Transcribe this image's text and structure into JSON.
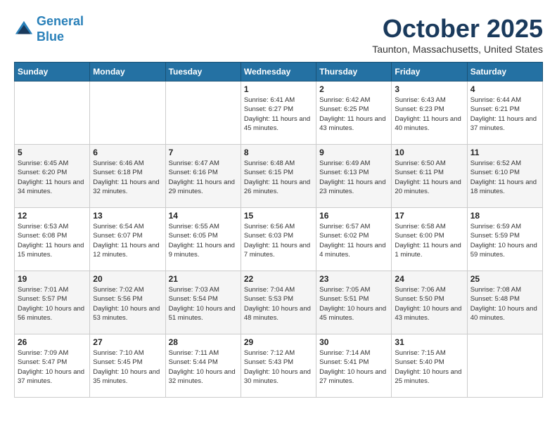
{
  "header": {
    "logo_line1": "General",
    "logo_line2": "Blue",
    "month_title": "October 2025",
    "location": "Taunton, Massachusetts, United States"
  },
  "weekdays": [
    "Sunday",
    "Monday",
    "Tuesday",
    "Wednesday",
    "Thursday",
    "Friday",
    "Saturday"
  ],
  "weeks": [
    [
      {
        "day": "",
        "info": ""
      },
      {
        "day": "",
        "info": ""
      },
      {
        "day": "",
        "info": ""
      },
      {
        "day": "1",
        "info": "Sunrise: 6:41 AM\nSunset: 6:27 PM\nDaylight: 11 hours\nand 45 minutes."
      },
      {
        "day": "2",
        "info": "Sunrise: 6:42 AM\nSunset: 6:25 PM\nDaylight: 11 hours\nand 43 minutes."
      },
      {
        "day": "3",
        "info": "Sunrise: 6:43 AM\nSunset: 6:23 PM\nDaylight: 11 hours\nand 40 minutes."
      },
      {
        "day": "4",
        "info": "Sunrise: 6:44 AM\nSunset: 6:21 PM\nDaylight: 11 hours\nand 37 minutes."
      }
    ],
    [
      {
        "day": "5",
        "info": "Sunrise: 6:45 AM\nSunset: 6:20 PM\nDaylight: 11 hours\nand 34 minutes."
      },
      {
        "day": "6",
        "info": "Sunrise: 6:46 AM\nSunset: 6:18 PM\nDaylight: 11 hours\nand 32 minutes."
      },
      {
        "day": "7",
        "info": "Sunrise: 6:47 AM\nSunset: 6:16 PM\nDaylight: 11 hours\nand 29 minutes."
      },
      {
        "day": "8",
        "info": "Sunrise: 6:48 AM\nSunset: 6:15 PM\nDaylight: 11 hours\nand 26 minutes."
      },
      {
        "day": "9",
        "info": "Sunrise: 6:49 AM\nSunset: 6:13 PM\nDaylight: 11 hours\nand 23 minutes."
      },
      {
        "day": "10",
        "info": "Sunrise: 6:50 AM\nSunset: 6:11 PM\nDaylight: 11 hours\nand 20 minutes."
      },
      {
        "day": "11",
        "info": "Sunrise: 6:52 AM\nSunset: 6:10 PM\nDaylight: 11 hours\nand 18 minutes."
      }
    ],
    [
      {
        "day": "12",
        "info": "Sunrise: 6:53 AM\nSunset: 6:08 PM\nDaylight: 11 hours\nand 15 minutes."
      },
      {
        "day": "13",
        "info": "Sunrise: 6:54 AM\nSunset: 6:07 PM\nDaylight: 11 hours\nand 12 minutes."
      },
      {
        "day": "14",
        "info": "Sunrise: 6:55 AM\nSunset: 6:05 PM\nDaylight: 11 hours\nand 9 minutes."
      },
      {
        "day": "15",
        "info": "Sunrise: 6:56 AM\nSunset: 6:03 PM\nDaylight: 11 hours\nand 7 minutes."
      },
      {
        "day": "16",
        "info": "Sunrise: 6:57 AM\nSunset: 6:02 PM\nDaylight: 11 hours\nand 4 minutes."
      },
      {
        "day": "17",
        "info": "Sunrise: 6:58 AM\nSunset: 6:00 PM\nDaylight: 11 hours\nand 1 minute."
      },
      {
        "day": "18",
        "info": "Sunrise: 6:59 AM\nSunset: 5:59 PM\nDaylight: 10 hours\nand 59 minutes."
      }
    ],
    [
      {
        "day": "19",
        "info": "Sunrise: 7:01 AM\nSunset: 5:57 PM\nDaylight: 10 hours\nand 56 minutes."
      },
      {
        "day": "20",
        "info": "Sunrise: 7:02 AM\nSunset: 5:56 PM\nDaylight: 10 hours\nand 53 minutes."
      },
      {
        "day": "21",
        "info": "Sunrise: 7:03 AM\nSunset: 5:54 PM\nDaylight: 10 hours\nand 51 minutes."
      },
      {
        "day": "22",
        "info": "Sunrise: 7:04 AM\nSunset: 5:53 PM\nDaylight: 10 hours\nand 48 minutes."
      },
      {
        "day": "23",
        "info": "Sunrise: 7:05 AM\nSunset: 5:51 PM\nDaylight: 10 hours\nand 45 minutes."
      },
      {
        "day": "24",
        "info": "Sunrise: 7:06 AM\nSunset: 5:50 PM\nDaylight: 10 hours\nand 43 minutes."
      },
      {
        "day": "25",
        "info": "Sunrise: 7:08 AM\nSunset: 5:48 PM\nDaylight: 10 hours\nand 40 minutes."
      }
    ],
    [
      {
        "day": "26",
        "info": "Sunrise: 7:09 AM\nSunset: 5:47 PM\nDaylight: 10 hours\nand 37 minutes."
      },
      {
        "day": "27",
        "info": "Sunrise: 7:10 AM\nSunset: 5:45 PM\nDaylight: 10 hours\nand 35 minutes."
      },
      {
        "day": "28",
        "info": "Sunrise: 7:11 AM\nSunset: 5:44 PM\nDaylight: 10 hours\nand 32 minutes."
      },
      {
        "day": "29",
        "info": "Sunrise: 7:12 AM\nSunset: 5:43 PM\nDaylight: 10 hours\nand 30 minutes."
      },
      {
        "day": "30",
        "info": "Sunrise: 7:14 AM\nSunset: 5:41 PM\nDaylight: 10 hours\nand 27 minutes."
      },
      {
        "day": "31",
        "info": "Sunrise: 7:15 AM\nSunset: 5:40 PM\nDaylight: 10 hours\nand 25 minutes."
      },
      {
        "day": "",
        "info": ""
      }
    ]
  ]
}
